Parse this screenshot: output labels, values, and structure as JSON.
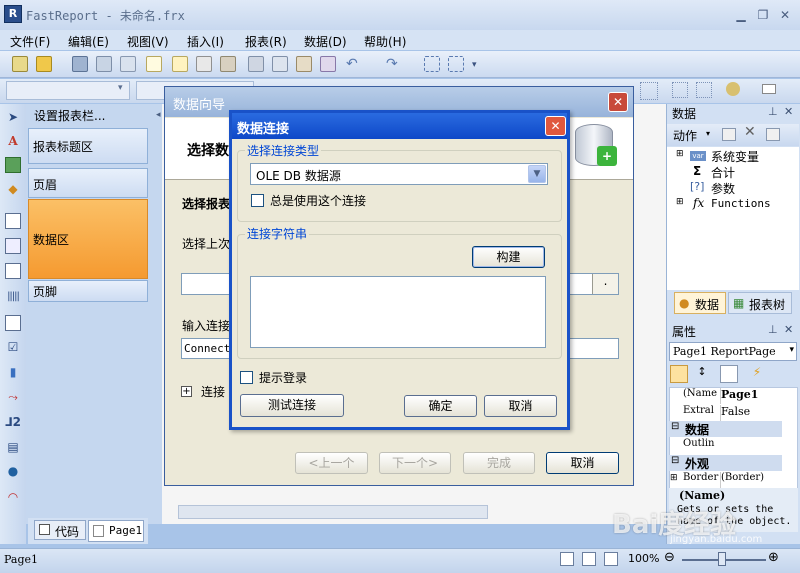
{
  "app": {
    "title": "FastReport - 未命名.frx",
    "icon_letter": "R"
  },
  "menu": [
    "文件(F)",
    "编辑(E)",
    "视图(V)",
    "插入(I)",
    "报表(R)",
    "数据(D)",
    "帮助(H)"
  ],
  "band_panel": {
    "header": "设置报表栏...",
    "bands": [
      "报表标题区",
      "页眉",
      "数据区",
      "页脚"
    ]
  },
  "tabs": {
    "code": "代码",
    "page": "Page1"
  },
  "data_panel": {
    "title": "数据",
    "action": "动作",
    "tree": [
      "系统变量",
      "合计",
      "参数",
      "Functions"
    ],
    "tab_data": "数据",
    "tab_report_tree": "报表树"
  },
  "props_panel": {
    "title": "属性",
    "selector": "Page1 ReportPage",
    "rows": [
      {
        "name": "(Name",
        "value": "Page1"
      },
      {
        "name": "Extral",
        "value": "False"
      },
      {
        "cat": "数据"
      },
      {
        "name": "Outlin",
        "value": ""
      },
      {
        "cat": "外观"
      },
      {
        "name": "Border",
        "value": "(Border)"
      }
    ],
    "help_name": "(Name)",
    "help_text": "Gets or sets the name of the object."
  },
  "status": {
    "page": "Page1",
    "zoom": "100%"
  },
  "wizard": {
    "title": "数据向导",
    "heading": "选择数",
    "section": "选择报表",
    "choose_label": "选择上次",
    "conn_field_value": "",
    "conn_label": "输入连接",
    "conn_string_value": "Connectio",
    "connect_expand": "连接",
    "buttons": {
      "prev": "<上一个",
      "next": "下一个>",
      "finish": "完成",
      "cancel": "取消"
    }
  },
  "conn_dialog": {
    "title": "数据连接",
    "type_group": "选择连接类型",
    "type_value": "OLE DB 数据源",
    "always_use": "总是使用这个连接",
    "string_group": "连接字符串",
    "build": "构建",
    "conn_string": "",
    "prompt_login": "提示登录",
    "test": "测试连接",
    "ok": "确定",
    "cancel": "取消"
  },
  "watermark": {
    "text": "Bai度经验",
    "url": "jingyan.baidu.com"
  },
  "colors": {
    "active_band": "#f9a53c",
    "dialog_title": "#1952c8",
    "accent": "#0046d5"
  }
}
